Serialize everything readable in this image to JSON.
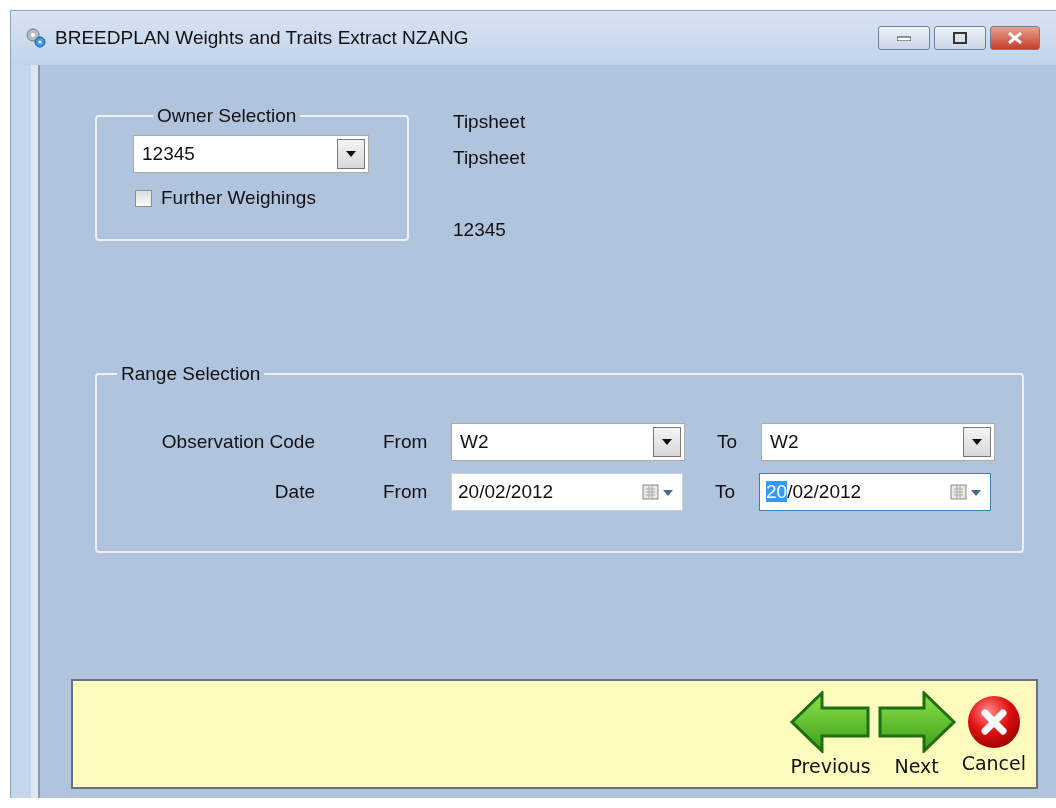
{
  "window": {
    "title": "BREEDPLAN Weights and Traits Extract NZANG"
  },
  "owner_selection": {
    "title": "Owner Selection",
    "owner": {
      "value": "12345"
    },
    "further_weighings": {
      "label": "Further Weighings",
      "checked": false
    }
  },
  "info_labels": [
    "Tipsheet",
    "Tipsheet",
    "12345"
  ],
  "range_selection": {
    "title": "Range Selection",
    "rows": [
      {
        "kind": "combo",
        "label": "Observation Code",
        "from_label": "From",
        "from": {
          "value": "W2"
        },
        "to_label": "To",
        "to": {
          "value": "W2"
        }
      },
      {
        "kind": "date",
        "label": "Date",
        "from_label": "From",
        "from": {
          "value": "20/02/2012",
          "focused": false
        },
        "to_label": "To",
        "to": {
          "value": "20/02/2012",
          "focused": true
        }
      }
    ]
  },
  "footer_buttons": [
    {
      "kind": "previous",
      "label": "Previous"
    },
    {
      "kind": "next",
      "label": "Next"
    },
    {
      "kind": "cancel",
      "label": "Cancel"
    }
  ]
}
